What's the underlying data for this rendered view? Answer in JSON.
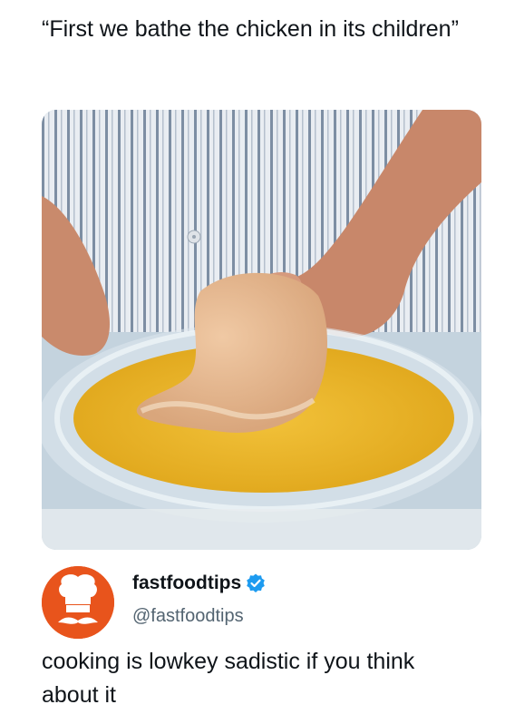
{
  "quote_caption": "“First we bathe the chicken in its children”",
  "photo": {
    "subject": "chicken-cutlet-dipped-in-egg-wash-photo"
  },
  "author": {
    "display_name": "fastfoodtips",
    "handle": "@fastfoodtips",
    "verified": true,
    "avatar_icon": "chef-hat-mustache-icon",
    "avatar_color": "#e8541c",
    "verified_color": "#1d9bf0"
  },
  "tweet_text": "cooking is lowkey sadistic if you think about it"
}
